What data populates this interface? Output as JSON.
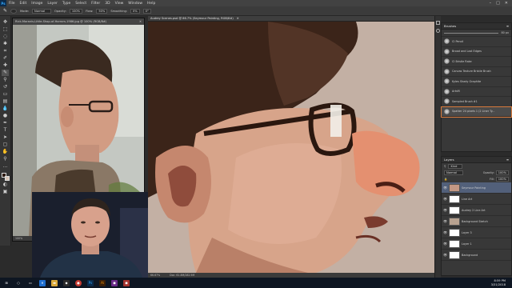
{
  "menu": {
    "logo": "Ps",
    "items": [
      "File",
      "Edit",
      "Image",
      "Layer",
      "Type",
      "Select",
      "Filter",
      "3D",
      "View",
      "Window",
      "Help"
    ]
  },
  "options": {
    "mode_label": "Mode:",
    "mode_value": "Normal",
    "opacity_label": "Opacity:",
    "opacity_value": "100%",
    "flow_label": "Flow:",
    "flow_value": "50%",
    "smoothing_label": "Smoothing:",
    "smoothing_value": "0%",
    "angle_value": "0°"
  },
  "reference_window": {
    "title": "Rick-Moranis-Little-Shop-of-Horrors-1986.jpg @ 100% (RGB/8#)",
    "zoom": "100%",
    "doc_info": "Doc: 1.86M/1.86M"
  },
  "document": {
    "tab_title": "Audrey Scenes.psd @ 66.7% (Seymour Painting, RGB/8#)",
    "zoom": "66.67%",
    "doc_info": "Doc: 61.8M/282.9M"
  },
  "brushes": {
    "title": "Brushes",
    "size_value": "80 px",
    "items": [
      {
        "name": "CI Pencil"
      },
      {
        "name": "Broad and Lost Edges"
      },
      {
        "name": "CI Bristle Rake"
      },
      {
        "name": "Canvas Texture Bristle Brush"
      },
      {
        "name": "Kyles Shady Graphite"
      },
      {
        "name": "ArtsM"
      },
      {
        "name": "Sampled Brush #1"
      },
      {
        "name": "Spatter 24 pixels 1 (2 Liner Ty..."
      }
    ]
  },
  "layers": {
    "title": "Layers",
    "kind_label": "Kind",
    "blend_value": "Normal",
    "opacity_label": "Opacity:",
    "opacity_value": "100%",
    "fill_label": "Fill:",
    "fill_value": "100%",
    "items": [
      {
        "name": "Seymour Painting",
        "selected": true
      },
      {
        "name": "Line Art",
        "selected": false
      },
      {
        "name": "Audrey 2 Line Art",
        "selected": false
      },
      {
        "name": "Background Sketch",
        "selected": false
      },
      {
        "name": "Layer 3",
        "selected": false
      },
      {
        "name": "Layer 1",
        "selected": false
      },
      {
        "name": "Background",
        "selected": false
      }
    ]
  },
  "taskbar": {
    "time": "8:59 PM",
    "date": "3/31/2018"
  },
  "colors": {
    "ps_blue": "#31a8ff",
    "selection_outline": "#d87a3c",
    "layer_selected": "#52607a"
  }
}
